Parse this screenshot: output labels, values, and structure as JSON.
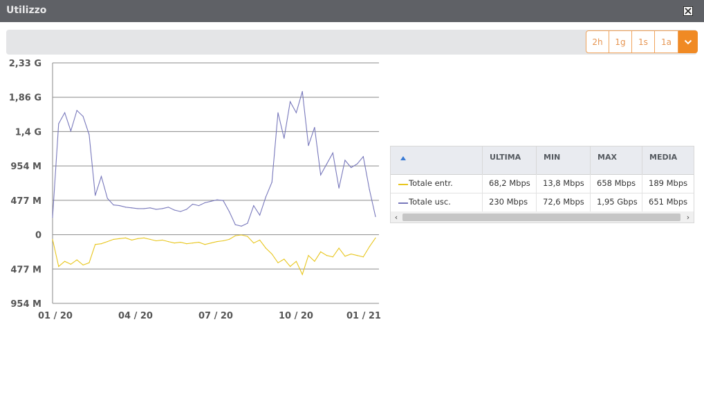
{
  "window": {
    "title": "Utilizzo",
    "close_icon": "close-icon"
  },
  "toolbar": {
    "range_buttons": [
      "2h",
      "1g",
      "1s",
      "1a"
    ],
    "dropdown_icon": "chevron-down-icon",
    "accent_color": "#f08a24"
  },
  "chart_data": {
    "type": "line",
    "title": "",
    "xlabel": "",
    "ylabel": "",
    "ylim": [
      -954,
      2330
    ],
    "y_unit": "M",
    "y_ticks": [
      "2,33 G",
      "1,86 G",
      "1,4 G",
      "954 M",
      "477 M",
      "0",
      "477 M",
      "954 M"
    ],
    "x_ticks": [
      "01 / 20",
      "04 / 20",
      "07 / 20",
      "10 / 20",
      "01 / 21"
    ],
    "grid": true,
    "note_negative": "Totale entr. plotted below zero axis",
    "series": [
      {
        "name": "Totale usc.",
        "color": "#7777bb",
        "x": [
          "2020-01-01",
          "2020-01-08",
          "2020-01-15",
          "2020-01-22",
          "2020-01-29",
          "2020-02-05",
          "2020-02-12",
          "2020-02-19",
          "2020-02-26",
          "2020-03-04",
          "2020-03-11",
          "2020-03-18",
          "2020-03-25",
          "2020-04-01",
          "2020-04-08",
          "2020-04-15",
          "2020-04-22",
          "2020-04-29",
          "2020-05-06",
          "2020-05-13",
          "2020-05-20",
          "2020-05-27",
          "2020-06-03",
          "2020-06-10",
          "2020-06-17",
          "2020-06-24",
          "2020-07-01",
          "2020-07-08",
          "2020-07-15",
          "2020-07-22",
          "2020-07-29",
          "2020-08-05",
          "2020-08-12",
          "2020-08-19",
          "2020-08-26",
          "2020-09-02",
          "2020-09-09",
          "2020-09-16",
          "2020-09-23",
          "2020-09-30",
          "2020-10-07",
          "2020-10-14",
          "2020-10-21",
          "2020-10-28",
          "2020-11-04",
          "2020-11-11",
          "2020-11-18",
          "2020-11-25",
          "2020-12-02",
          "2020-12-09",
          "2020-12-16",
          "2020-12-23",
          "2020-12-30",
          "2021-01-06"
        ],
        "values": [
          220,
          1500,
          1650,
          1400,
          1680,
          1600,
          1350,
          520,
          780,
          480,
          390,
          380,
          360,
          350,
          340,
          340,
          350,
          330,
          340,
          360,
          320,
          300,
          330,
          400,
          380,
          420,
          440,
          460,
          450,
          300,
          120,
          100,
          140,
          380,
          250,
          500,
          700,
          1650,
          1300,
          1800,
          1650,
          1940,
          1200,
          1450,
          800,
          950,
          1100,
          620,
          1000,
          900,
          950,
          1050,
          600,
          230
        ]
      },
      {
        "name": "Totale entr.",
        "color": "#e8c61d",
        "x": [
          "2020-01-01",
          "2020-01-08",
          "2020-01-15",
          "2020-01-22",
          "2020-01-29",
          "2020-02-05",
          "2020-02-12",
          "2020-02-19",
          "2020-02-26",
          "2020-03-04",
          "2020-03-11",
          "2020-03-18",
          "2020-03-25",
          "2020-04-01",
          "2020-04-08",
          "2020-04-15",
          "2020-04-22",
          "2020-04-29",
          "2020-05-06",
          "2020-05-13",
          "2020-05-20",
          "2020-05-27",
          "2020-06-03",
          "2020-06-10",
          "2020-06-17",
          "2020-06-24",
          "2020-07-01",
          "2020-07-08",
          "2020-07-15",
          "2020-07-22",
          "2020-07-29",
          "2020-08-05",
          "2020-08-12",
          "2020-08-19",
          "2020-08-26",
          "2020-09-02",
          "2020-09-09",
          "2020-09-16",
          "2020-09-23",
          "2020-09-30",
          "2020-10-07",
          "2020-10-14",
          "2020-10-21",
          "2020-10-28",
          "2020-11-04",
          "2020-11-11",
          "2020-11-18",
          "2020-11-25",
          "2020-12-02",
          "2020-12-09",
          "2020-12-16",
          "2020-12-23",
          "2020-12-30",
          "2021-01-06"
        ],
        "values": [
          -80,
          -450,
          -380,
          -420,
          -360,
          -430,
          -400,
          -150,
          -140,
          -110,
          -80,
          -70,
          -60,
          -90,
          -70,
          -60,
          -80,
          -100,
          -90,
          -110,
          -130,
          -120,
          -140,
          -130,
          -120,
          -150,
          -130,
          -110,
          -100,
          -80,
          -30,
          -20,
          -40,
          -130,
          -90,
          -200,
          -280,
          -400,
          -350,
          -450,
          -380,
          -560,
          -300,
          -380,
          -250,
          -300,
          -320,
          -200,
          -310,
          -280,
          -300,
          -320,
          -180,
          -60
        ]
      }
    ]
  },
  "legend_table": {
    "sort_icon": "sort-asc-icon",
    "columns": [
      "ULTIMA",
      "MIN",
      "MAX",
      "MEDIA"
    ],
    "rows": [
      {
        "name": "Totale entr.",
        "color": "#e8c61d",
        "ultima": "68,2 Mbps",
        "min": "13,8 Mbps",
        "max": "658 Mbps",
        "media": "189 Mbps"
      },
      {
        "name": "Totale usc.",
        "color": "#7777bb",
        "ultima": "230 Mbps",
        "min": "72,6 Mbps",
        "max": "1,95 Gbps",
        "media": "651 Mbps"
      }
    ],
    "scroll_left": "‹",
    "scroll_right": "›"
  }
}
